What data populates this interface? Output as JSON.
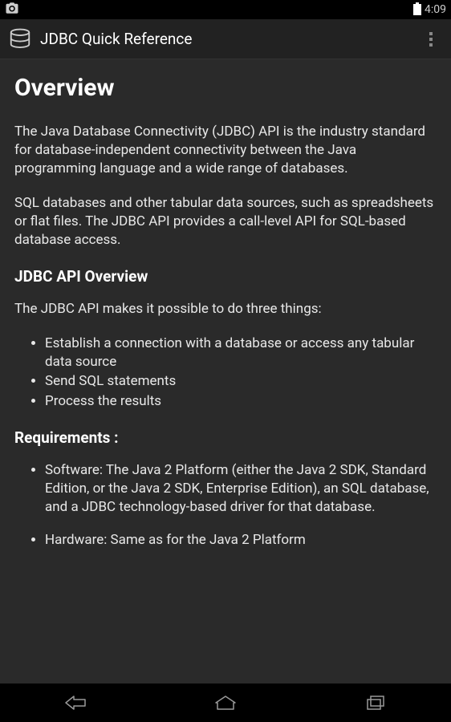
{
  "statusBar": {
    "time": "4:09"
  },
  "actionBar": {
    "title": "JDBC Quick Reference"
  },
  "content": {
    "heading": "Overview",
    "para1": "The Java Database Connectivity (JDBC) API is the industry standard for database-independent connectivity between the Java programming language and a wide range of databases.",
    "para2": "SQL databases and other tabular data sources, such as spreadsheets or flat files. The JDBC API provides a call-level API for SQL-based database access.",
    "subheading1": "JDBC API Overview",
    "para3": "The JDBC API makes it possible to do three things:",
    "list1": {
      "item1": "Establish a connection with a database or access any tabular data source",
      "item2": "Send SQL statements",
      "item3": "Process the results"
    },
    "subheading2": "Requirements :",
    "list2": {
      "item1": "Software: The Java 2 Platform (either the Java 2 SDK, Standard Edition, or the Java 2 SDK, Enterprise Edition), an SQL database, and a JDBC technology-based driver for that database.",
      "item2": "Hardware: Same as for the Java 2 Platform"
    }
  }
}
